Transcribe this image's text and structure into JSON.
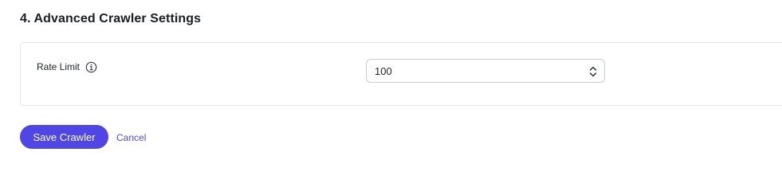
{
  "section": {
    "title": "4. Advanced Crawler Settings"
  },
  "rate_limit": {
    "label": "Rate Limit",
    "info_icon": "info-circle-icon",
    "value": "100",
    "control_icon": "chevron-up-down-icon"
  },
  "actions": {
    "save_label": "Save Crawler",
    "cancel_label": "Cancel"
  },
  "colors": {
    "accent": "#4f46e5",
    "border": "#e4e6ea"
  }
}
